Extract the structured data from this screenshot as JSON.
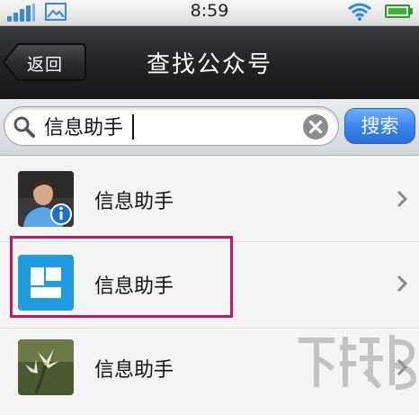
{
  "status_bar": {
    "time": "8:59",
    "signal_icon": "signal-bars-icon",
    "image_icon": "gallery-icon",
    "wifi_icon": "wifi-icon",
    "battery_icon": "battery-icon",
    "accent": "#3d86d8"
  },
  "nav": {
    "back_label": "返回",
    "title": "查找公众号"
  },
  "search": {
    "value": "信息助手",
    "button_label": "搜索",
    "search_icon": "magnifier-icon",
    "clear_icon": "clear-circle-icon",
    "button_color": "#3b85ee"
  },
  "results": [
    {
      "name": "信息助手",
      "avatar_icon": "person-info-avatar"
    },
    {
      "name": "信息助手",
      "avatar_icon": "blue-square-logo"
    },
    {
      "name": "信息助手",
      "avatar_icon": "flower-photo"
    }
  ],
  "highlight_color": "#c3175f",
  "watermark": "下载吧"
}
